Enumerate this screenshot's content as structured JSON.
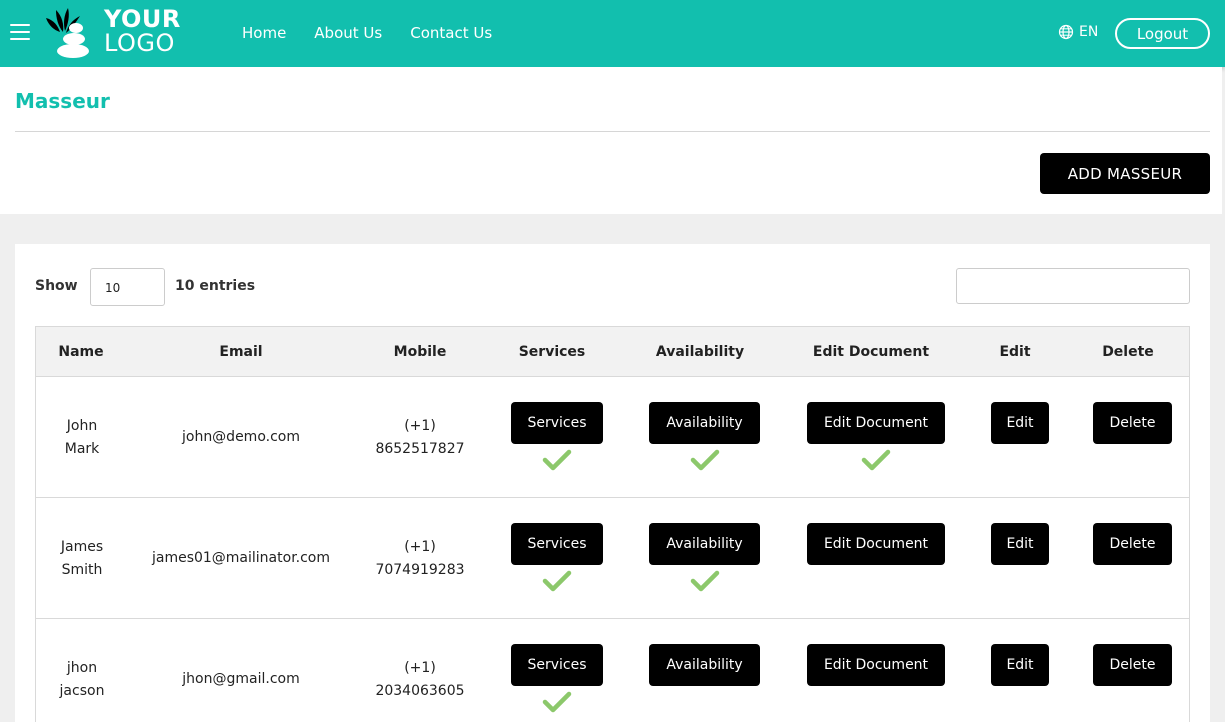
{
  "header": {
    "logo_line1": "YOUR",
    "logo_line2": "LOGO",
    "nav": [
      "Home",
      "About Us",
      "Contact Us"
    ],
    "language": "EN",
    "logout_label": "Logout",
    "accent_color": "#12bfae"
  },
  "page": {
    "title": "Masseur",
    "add_button_label": "ADD MASSEUR"
  },
  "table_controls": {
    "show_label": "Show",
    "entries_value": "10",
    "entries_label": "10 entries",
    "search_value": ""
  },
  "table": {
    "columns": [
      "Name",
      "Email",
      "Mobile",
      "Services",
      "Availability",
      "Edit Document",
      "Edit",
      "Delete"
    ],
    "button_labels": {
      "services": "Services",
      "availability": "Availability",
      "edit_document": "Edit Document",
      "edit": "Edit",
      "delete": "Delete"
    },
    "rows": [
      {
        "name_line1": "John",
        "name_line2": "Mark",
        "email": "john@demo.com",
        "mobile_code": "(+1)",
        "mobile_number": "8652517827",
        "services_done": true,
        "availability_done": true,
        "document_done": true
      },
      {
        "name_line1": "James",
        "name_line2": "Smith",
        "email": "james01@mailinator.com",
        "mobile_code": "(+1)",
        "mobile_number": "7074919283",
        "services_done": true,
        "availability_done": true,
        "document_done": false
      },
      {
        "name_line1": "jhon",
        "name_line2": "jacson",
        "email": "jhon@gmail.com",
        "mobile_code": "(+1)",
        "mobile_number": "2034063605",
        "services_done": true,
        "availability_done": false,
        "document_done": false
      }
    ]
  }
}
